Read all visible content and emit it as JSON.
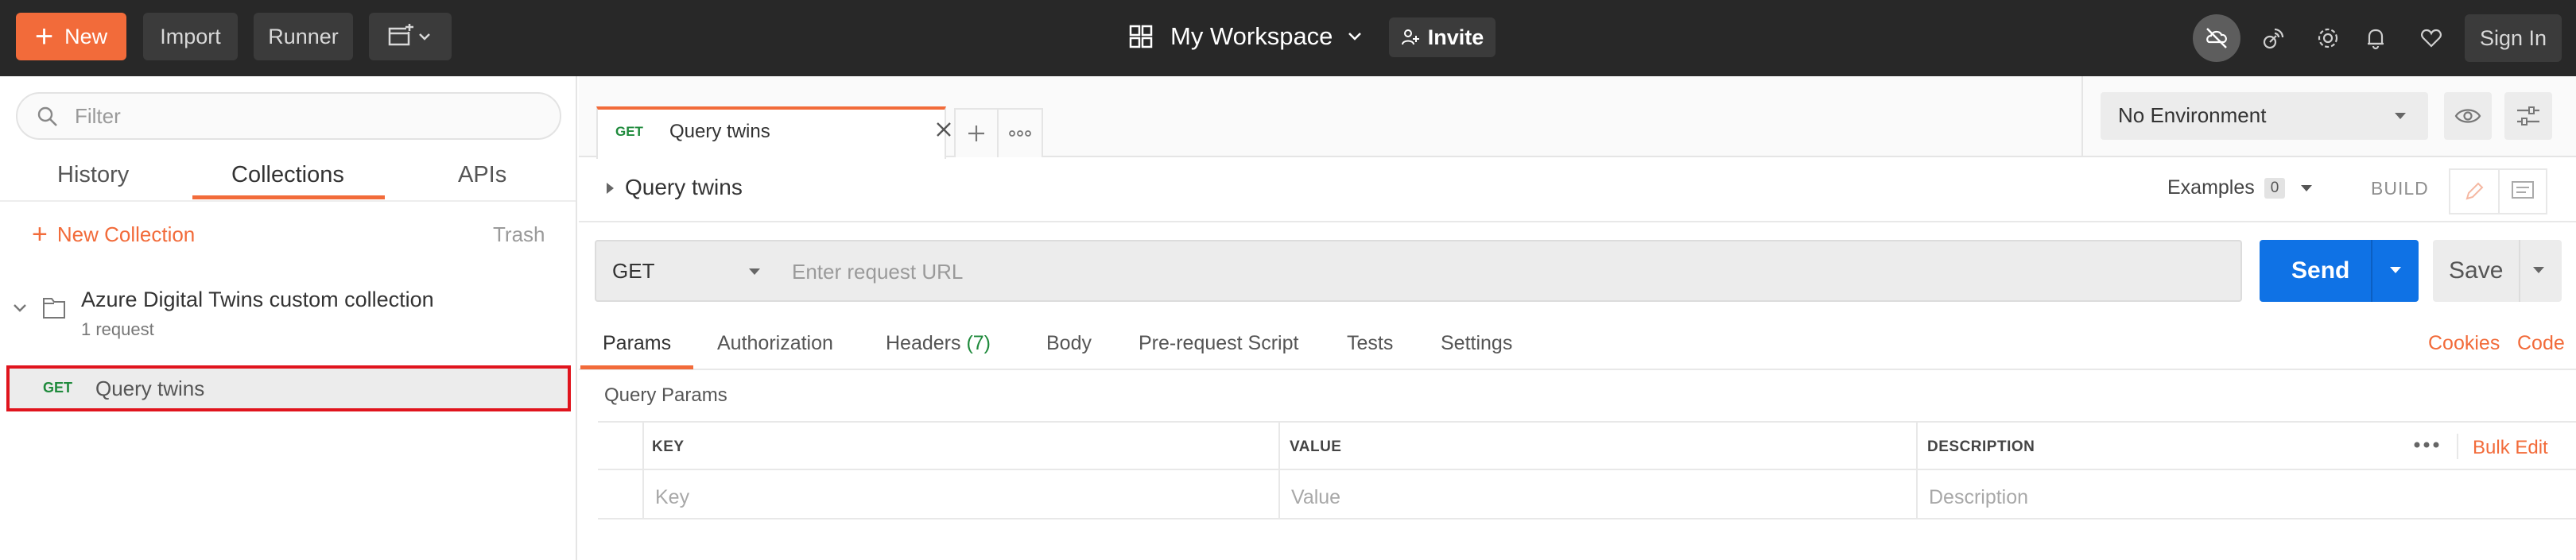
{
  "topbar": {
    "new_label": "New",
    "import_label": "Import",
    "runner_label": "Runner",
    "workspace_label": "My Workspace",
    "invite_label": "Invite",
    "signin_label": "Sign In"
  },
  "sidebar": {
    "filter_placeholder": "Filter",
    "tabs": [
      "History",
      "Collections",
      "APIs"
    ],
    "active_tab": "Collections",
    "new_collection_label": "New Collection",
    "trash_label": "Trash",
    "collection": {
      "name": "Azure Digital Twins custom collection",
      "count": "1 request",
      "requests": [
        {
          "method": "GET",
          "name": "Query twins"
        }
      ]
    }
  },
  "request_tab": {
    "method": "GET",
    "name": "Query twins"
  },
  "environment": {
    "selected": "No Environment"
  },
  "request": {
    "title": "Query twins",
    "examples_label": "Examples",
    "examples_count": "0",
    "build_label": "BUILD",
    "method": "GET",
    "url_placeholder": "Enter request URL",
    "send_label": "Send",
    "save_label": "Save"
  },
  "subtabs": {
    "params": "Params",
    "authorization": "Authorization",
    "headers": "Headers",
    "headers_count": "(7)",
    "body": "Body",
    "prerequest": "Pre-request Script",
    "tests": "Tests",
    "settings": "Settings",
    "cookies": "Cookies",
    "code": "Code"
  },
  "params": {
    "section_title": "Query Params",
    "columns": [
      "KEY",
      "VALUE",
      "DESCRIPTION"
    ],
    "placeholders": [
      "Key",
      "Value",
      "Description"
    ],
    "bulk_edit_label": "Bulk Edit"
  },
  "colors": {
    "accent": "#f26b3a",
    "send_blue": "#0f72e5",
    "get_green": "#1f8a3c",
    "highlight_red": "#e0141d",
    "topbar_bg": "#282828"
  }
}
